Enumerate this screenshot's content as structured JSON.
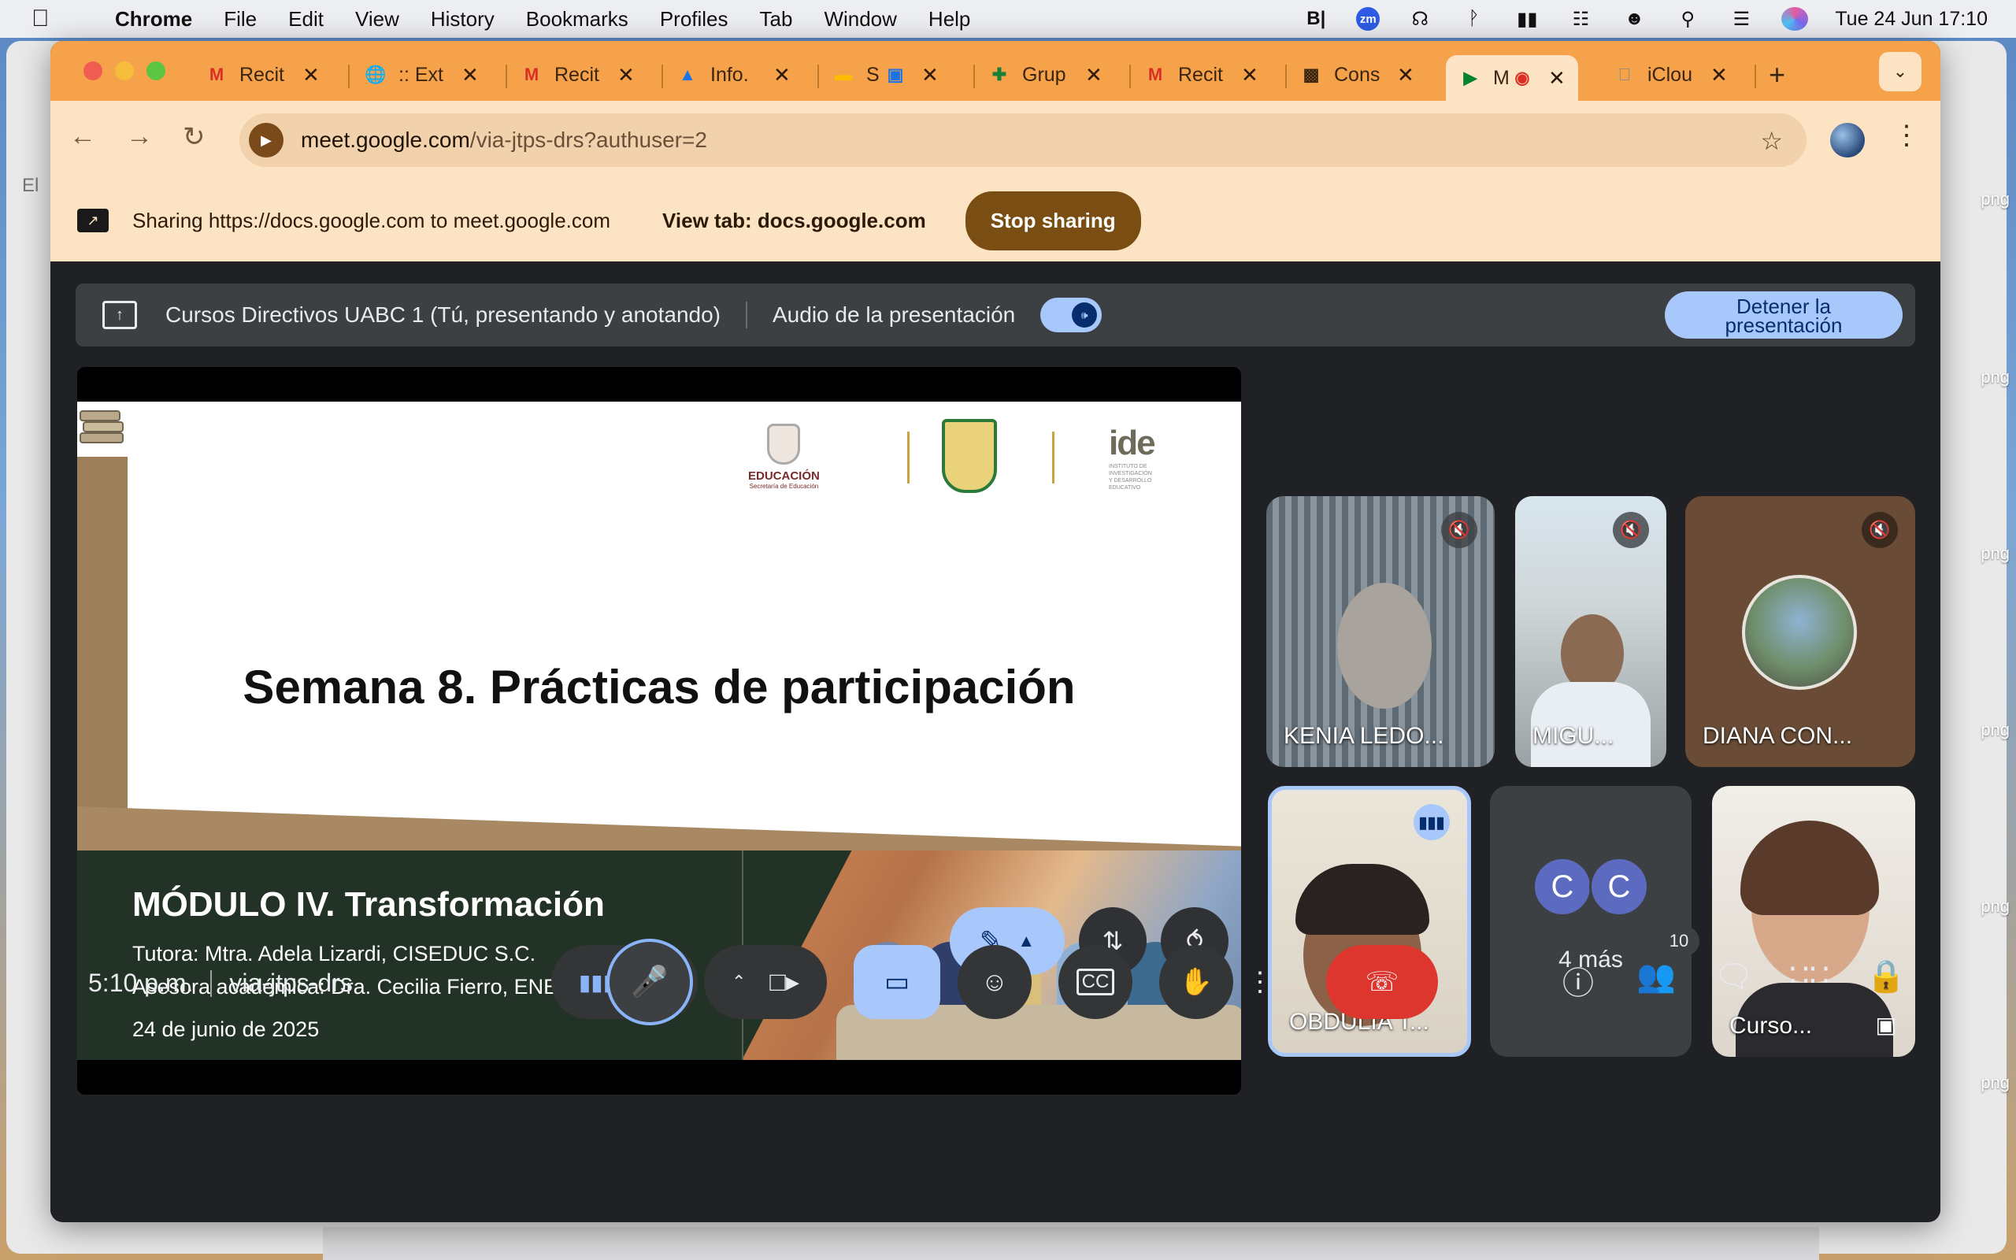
{
  "menubar": {
    "app": "Chrome",
    "items": [
      "File",
      "Edit",
      "View",
      "History",
      "Bookmarks",
      "Profiles",
      "Tab",
      "Window",
      "Help"
    ],
    "status_icons": [
      "bluetooth-icon",
      "zoom-icon",
      "headphones-icon",
      "bluetooth-icon",
      "battery-icon",
      "wifi-icon",
      "user-icon",
      "search-icon",
      "control-center-icon",
      "siri-icon"
    ],
    "zoom_label": "zm",
    "clock": "Tue 24 Jun  17:10"
  },
  "behind": {
    "left_label": "El",
    "desktop_files": [
      "png",
      "png",
      "png",
      "png",
      "png",
      "png"
    ]
  },
  "tabs": [
    {
      "label": "Recit",
      "icon": "gmail-icon"
    },
    {
      "label": ":: Ext",
      "icon": "globe-icon"
    },
    {
      "label": "Recit",
      "icon": "gmail-icon"
    },
    {
      "label": "Info.",
      "icon": "drive-icon"
    },
    {
      "label": "S",
      "icon": "slides-icon"
    },
    {
      "label": "Grup",
      "icon": "sheets-icon"
    },
    {
      "label": "Recit",
      "icon": "gmail-icon"
    },
    {
      "label": "Cons",
      "icon": "contact-card-icon"
    },
    {
      "label": "M",
      "icon": "meet-icon"
    },
    {
      "label": "iClou",
      "icon": "apple-icon"
    }
  ],
  "toolbar": {
    "url_host": "meet.google.com",
    "url_path": "/via-jtps-drs?authuser=2"
  },
  "sharebar": {
    "text": "Sharing https://docs.google.com to meet.google.com",
    "view_tab": "View tab: docs.google.com",
    "stop": "Stop sharing"
  },
  "presbar": {
    "title": "Cursos Directivos UABC 1 (Tú, presentando y anotando)",
    "audio": "Audio de la presentación",
    "stop_line1": "Detener la",
    "stop_line2": "presentación"
  },
  "slide": {
    "title": "Semana 8. Prácticas de participación",
    "logo_ed": "EDUCACIÓN",
    "logo_ed_sub": "Secretaría de Educación",
    "logo_ide": "ide",
    "logo_ide_sub": "INSTITUTO DE INVESTIGACIÓN Y DESARROLLO EDUCATIVO",
    "module": "MÓDULO IV. Transformación",
    "tutora": "Tutora: Mtra. Adela Lizardi, CISEDUC S.C.",
    "asesora": "Asesora académica: Dra. Cecilia Fierro, ENES-UNAM",
    "date": "24 de junio de 2025"
  },
  "participants": [
    {
      "name": "KENIA LEDO..."
    },
    {
      "name": "MIGU..."
    },
    {
      "name": "DIANA CON..."
    },
    {
      "name": "OBDULIA T..."
    },
    {
      "name": "Curso..."
    }
  ],
  "more_tile": {
    "initials": [
      "C",
      "C"
    ],
    "label": "4 más"
  },
  "bottom": {
    "time": "5:10 p.m.",
    "code": "via-jtps-drs",
    "people_count": "10"
  }
}
